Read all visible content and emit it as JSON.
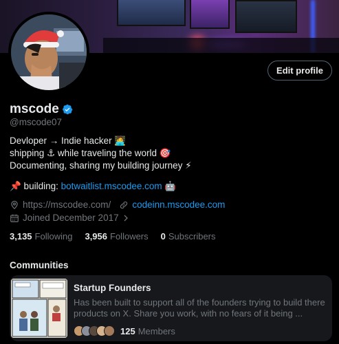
{
  "profile": {
    "name": "mscode",
    "handle": "@mscode07",
    "edit_label": "Edit profile",
    "bio_line1": "Devloper → Indie hacker 🧑‍💻",
    "bio_line2": "shipping ⚓ while traveling the world 🎯",
    "bio_line3": "Documenting, sharing my building journey ⚡",
    "building_prefix": "📌 building: ",
    "building_link": "botwaitlist.mscodee.com",
    "building_suffix": " 🤖",
    "website": "https://mscodee.com/",
    "link2": "codeinn.mscodee.com",
    "joined": "Joined December 2017",
    "verified_icon": "verified-badge-icon",
    "accent_color": "#1d9bf0"
  },
  "stats": {
    "following_count": "3,135",
    "following_label": "Following",
    "followers_count": "3,956",
    "followers_label": "Followers",
    "subscribers_count": "0",
    "subscribers_label": "Subscribers"
  },
  "communities": {
    "title": "Communities",
    "items": [
      {
        "name": "Startup Founders",
        "description": "Has been built to support all of the founders trying to build there products on X. Share you work, with no fears of it being ...",
        "member_count": "125",
        "member_label": "Members"
      }
    ]
  }
}
